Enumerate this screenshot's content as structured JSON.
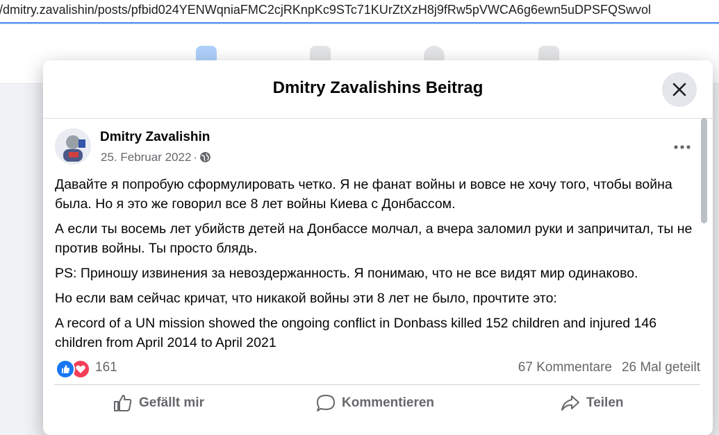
{
  "browser": {
    "url": "/dmitry.zavalishin/posts/pfbid024YENWqniaFMC2cjRKnpKc9STc71KUrZtXzH8j9fRw5pVWCA6g6ewn5uDPSFQSwvol"
  },
  "modal": {
    "title": "Dmitry Zavalishins Beitrag"
  },
  "post": {
    "author": "Dmitry Zavalishin",
    "date": "25. Februar 2022",
    "separator": "·",
    "paragraphs": [
      "Давайте я попробую сформулировать четко. Я не фанат войны и вовсе не хочу того, чтобы война была. Но я это же говорил все 8 лет войны Киева с Донбассом.",
      "А если ты восемь лет убийств детей на Донбассе молчал, а вчера заломил руки и запричитал, ты не против войны. Ты просто блядь.",
      "PS: Приношу извинения за невоздержанность. Я понимаю, что не все видят мир одинаково.",
      "Но если вам сейчас кричат, что никакой войны эти 8 лет не было, прочтите это:",
      "A record of a UN mission showed the ongoing conflict in Donbass killed 152 children and injured 146 children from April 2014 to April 2021"
    ],
    "reaction_count": "161",
    "comments": "67 Kommentare",
    "shares": "26 Mal geteilt"
  },
  "actions": {
    "like": "Gefällt mir",
    "comment": "Kommentieren",
    "share": "Teilen"
  },
  "icons": {
    "close": "close-icon",
    "more": "more-dots-icon",
    "privacy": "globe-icon",
    "like_reaction": "like-reaction-icon",
    "love_reaction": "love-reaction-icon"
  },
  "colors": {
    "like_blue": "#1877f2",
    "love_red": "#f33e58",
    "secondary_text": "#65676b",
    "url_underline": "#4285f4"
  }
}
